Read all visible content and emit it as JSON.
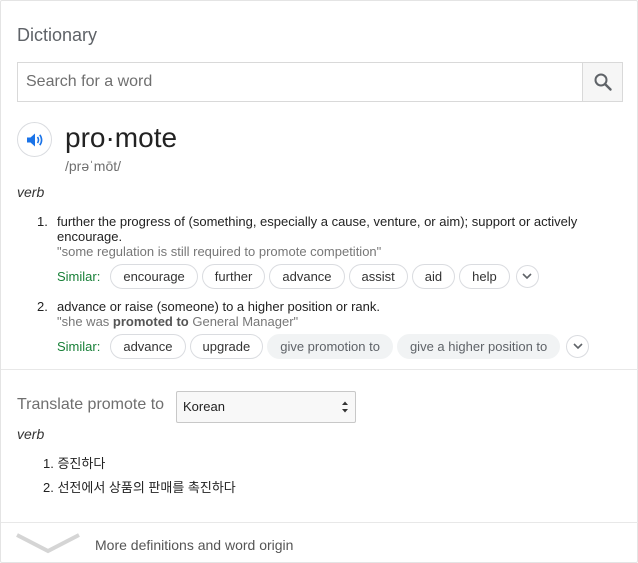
{
  "header": {
    "title": "Dictionary"
  },
  "search": {
    "placeholder": "Search for a word",
    "icon": "search-icon"
  },
  "entry": {
    "word": "pro·mote",
    "phonetic": "/prəˈmōt/",
    "pronounce_icon": "speaker-icon",
    "pos": "verb",
    "senses": [
      {
        "number": "1.",
        "definition": "further the progress of (something, especially a cause, venture, or aim); support or actively encourage.",
        "example": "\"some regulation is still required to promote competition\"",
        "similar_label": "Similar:",
        "similar": [
          "encourage",
          "further",
          "advance",
          "assist",
          "aid",
          "help"
        ]
      },
      {
        "number": "2.",
        "definition": "advance or raise (someone) to a higher position or rank.",
        "example_pre": "\"she was ",
        "example_bold": "promoted to",
        "example_post": " General Manager\"",
        "similar_label": "Similar:",
        "similar": [
          "advance",
          "upgrade"
        ],
        "similar_more": [
          "give promotion to",
          "give a higher position to"
        ]
      }
    ]
  },
  "translate": {
    "label": "Translate promote to",
    "language": "Korean",
    "pos": "verb",
    "items": [
      {
        "number": "1.",
        "text": "증진하다"
      },
      {
        "number": "2.",
        "text": "선전에서 상품의 판매를 촉진하다"
      }
    ]
  },
  "footer": {
    "more_label": "More definitions and word origin"
  },
  "colors": {
    "accent": "#1a73e8",
    "similar_green": "#188038",
    "muted": "#6f6f6f"
  }
}
